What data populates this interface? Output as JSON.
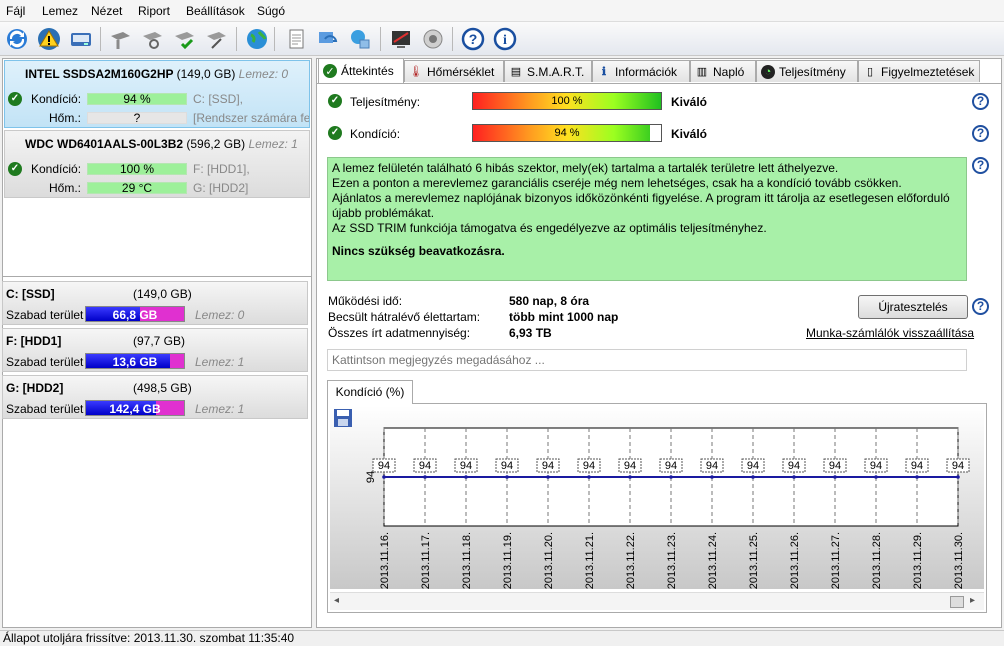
{
  "menu": [
    "Fájl",
    "Lemez",
    "Nézet",
    "Riport",
    "Beállítások",
    "Súgó"
  ],
  "disks": [
    {
      "model": "INTEL SSDSA2M160G2HP",
      "size": "(149,0 GB)",
      "lemez": "Lemez: 0",
      "condition_label": "Kondíció:",
      "condition": "94 %",
      "condition_fraction": 0.94,
      "condition_info": "C: [SSD],",
      "temp_label": "Hőm.:",
      "temp": "?",
      "temp_info": "[Rendszer számára fen"
    },
    {
      "model": "WDC WD6401AALS-00L3B2",
      "size": "(596,2 GB)",
      "lemez": "Lemez: 1",
      "condition_label": "Kondíció:",
      "condition": "100 %",
      "condition_fraction": 1.0,
      "condition_info": "F: [HDD1],",
      "temp_label": "Hőm.:",
      "temp": "29 °C",
      "temp_info": "G: [HDD2]"
    }
  ],
  "volumes": [
    {
      "name": "C: [SSD]",
      "size": "(149,0 GB)",
      "free_label": "Szabad terület",
      "free": "66,8 GB",
      "free_fraction": 0.55,
      "lemez": "Lemez: 0"
    },
    {
      "name": "F: [HDD1]",
      "size": "(97,7 GB)",
      "free_label": "Szabad terület",
      "free": "13,6 GB",
      "free_fraction": 0.86,
      "lemez": "Lemez: 1"
    },
    {
      "name": "G: [HDD2]",
      "size": "(498,5 GB)",
      "free_label": "Szabad terület",
      "free": "142,4 GB",
      "free_fraction": 0.71,
      "lemez": "Lemez: 1"
    }
  ],
  "tabs": [
    "Áttekintés",
    "Hőmérséklet",
    "S.M.A.R.T.",
    "Információk",
    "Napló",
    "Teljesítmény",
    "Figyelmeztetések"
  ],
  "overview": {
    "performance_label": "Teljesítmény:",
    "performance_value": "100 %",
    "performance_fraction": 1.0,
    "performance_rating": "Kiváló",
    "condition_label": "Kondíció:",
    "condition_value": "94 %",
    "condition_fraction": 0.94,
    "condition_rating": "Kiváló",
    "message_lines": [
      "A lemez felületén található 6 hibás szektor, mely(ek) tartalma a tartalék területre lett áthelyezve.",
      "Ezen a ponton a merevlemez garanciális cseréje még nem lehetséges, csak ha a kondíció tovább csökken.",
      "Ajánlatos a merevlemez naplójának bizonyos időközönkénti figyelése. A program itt tárolja az esetlegesen előforduló újabb problémákat.",
      "Az SSD TRIM funkciója támogatva és engedélyezve az optimális teljesítményhez."
    ],
    "message_conclusion": "Nincs szükség beavatkozásra.",
    "power_on_label": "Működési idő:",
    "power_on": "580 nap, 8 óra",
    "remaining_label": "Becsült hátralévő élettartam:",
    "remaining": "több mint 1000 nap",
    "written_label": "Összes írt adatmennyiség:",
    "written": "6,93 TB",
    "retest_button": "Újratesztelés",
    "reset_link": "Munka-számlálók visszaállítása",
    "note_placeholder": "Kattintson megjegyzés megadásához ...",
    "chart_tab": "Kondíció  (%)"
  },
  "chart_data": {
    "type": "line",
    "title": "Kondíció  (%)",
    "x": [
      "2013.11.16.",
      "2013.11.17.",
      "2013.11.18.",
      "2013.11.19.",
      "2013.11.20.",
      "2013.11.21.",
      "2013.11.22.",
      "2013.11.23.",
      "2013.11.24.",
      "2013.11.25.",
      "2013.11.26.",
      "2013.11.27.",
      "2013.11.28.",
      "2013.11.29.",
      "2013.11.30."
    ],
    "series": [
      {
        "values": [
          94,
          94,
          94,
          94,
          94,
          94,
          94,
          94,
          94,
          94,
          94,
          94,
          94,
          94,
          94
        ]
      }
    ],
    "ytick": "94",
    "ylim": [
      0,
      100
    ],
    "line_color": "#1a1aa0"
  },
  "status": "Állapot utoljára frissítve: 2013.11.30. szombat 11:35:40"
}
